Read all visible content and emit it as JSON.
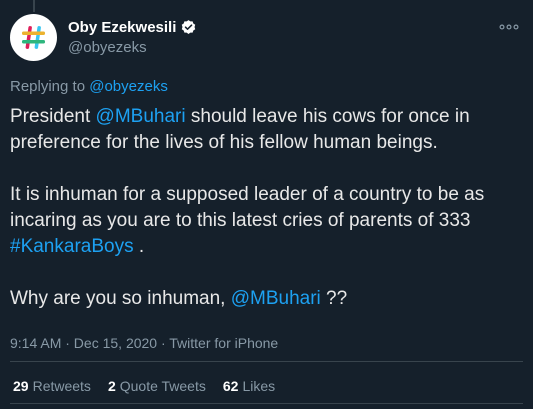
{
  "author": {
    "name": "Oby Ezekwesili",
    "handle": "@obyezeks",
    "verified": true,
    "avatar_icon": "hashtag-logo-icon"
  },
  "replying": {
    "prefix": "Replying to",
    "mention": "@obyezeks"
  },
  "tweet": {
    "p1_a": "President ",
    "p1_mention": "@MBuhari",
    "p1_b": " should leave his cows for once in preference for the lives of his fellow human beings.",
    "p2_a": "It is inhuman for a supposed leader of a country to be as incaring as you are to this latest cries of parents of 333 ",
    "p2_hashtag": "#KankaraBoys",
    "p2_b": " .",
    "p3_a": "Why are you so inhuman, ",
    "p3_mention": "@MBuhari",
    "p3_b": " ??"
  },
  "meta": {
    "timestamp": "9:14 AM · Dec 15, 2020 · Twitter for iPhone"
  },
  "stats": {
    "retweets_count": "29",
    "retweets_label": "Retweets",
    "quotes_count": "2",
    "quotes_label": "Quote Tweets",
    "likes_count": "62",
    "likes_label": "Likes"
  },
  "colors": {
    "background": "#15202b",
    "link": "#1da1f2",
    "secondary_text": "#8899a6",
    "divider": "#38444d"
  }
}
